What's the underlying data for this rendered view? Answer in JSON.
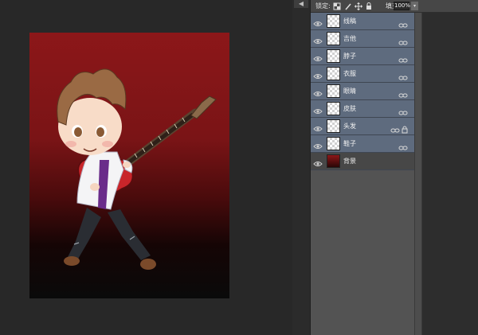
{
  "panel": {
    "lock_label": "锁定:",
    "fill_label": "填充:",
    "fill_value": "100%",
    "lock_icons": [
      "lock-transparent-icon",
      "lock-image-icon",
      "lock-position-icon",
      "lock-all-icon"
    ]
  },
  "layers": [
    {
      "name": "线稿",
      "linked": true,
      "locked": false,
      "selected": true
    },
    {
      "name": "吉他",
      "linked": true,
      "locked": false,
      "selected": true
    },
    {
      "name": "脖子",
      "linked": true,
      "locked": false,
      "selected": true
    },
    {
      "name": "衣服",
      "linked": true,
      "locked": false,
      "selected": true
    },
    {
      "name": "眼睛",
      "linked": true,
      "locked": false,
      "selected": true
    },
    {
      "name": "皮肤",
      "linked": true,
      "locked": false,
      "selected": true
    },
    {
      "name": "头发",
      "linked": true,
      "locked": true,
      "selected": true
    },
    {
      "name": "鞋子",
      "linked": true,
      "locked": false,
      "selected": true
    },
    {
      "name": "背景",
      "linked": false,
      "locked": false,
      "selected": false
    }
  ],
  "colors": {
    "canvas_top": "#8c1719",
    "canvas_bottom": "#0a0a0a",
    "layer_selected": "#5e6b7e",
    "panel_bg": "#535353"
  }
}
